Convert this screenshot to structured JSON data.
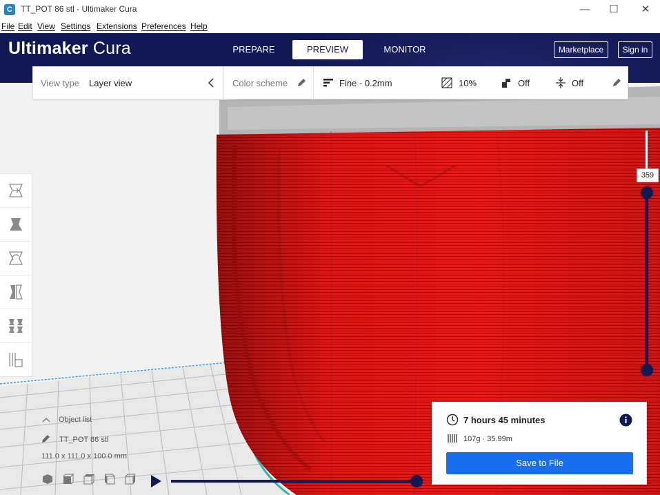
{
  "window": {
    "title": "TT_POT 86 stl - Ultimaker Cura",
    "app_icon": "C",
    "minimize": "—",
    "maximize": "☐",
    "close": "✕"
  },
  "menu": [
    "File",
    "Edit",
    "View",
    "Settings",
    "Extensions",
    "Preferences",
    "Help"
  ],
  "header": {
    "logo_bold": "Ultimaker",
    "logo_light": "Cura",
    "stages": [
      "PREPARE",
      "PREVIEW",
      "MONITOR"
    ],
    "active_stage": "PREVIEW",
    "marketplace": "Marketplace",
    "sign_in": "Sign in"
  },
  "viewbar": {
    "view_type_label": "View type",
    "view_type_value": "Layer view",
    "color_scheme_label": "Color scheme",
    "profile": "Fine - 0.2mm",
    "infill": "10%",
    "support": "Off",
    "adhesion": "Off"
  },
  "layer_slider": {
    "current_layer": "359"
  },
  "object": {
    "list_label": "Object list",
    "name": "TT_POT 86 stl",
    "dimensions": "111.0 x 111.0 x 100.0 mm"
  },
  "print_info": {
    "time": "7 hours 45 minutes",
    "material": "107g · 35.99m",
    "save_button": "Save to File"
  },
  "colors": {
    "header_bg": "#111954",
    "model_red": "#e61a1a",
    "accent_blue": "#196ef0"
  }
}
